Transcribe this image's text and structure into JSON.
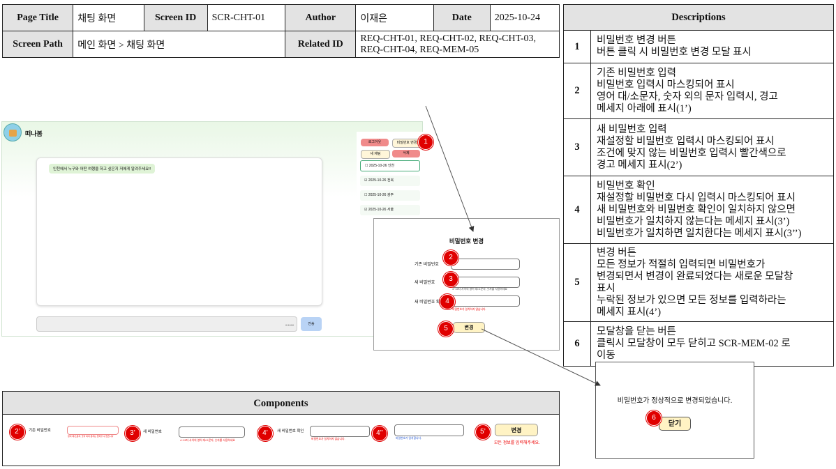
{
  "header": {
    "page_title_label": "Page Title",
    "page_title": "채팅 화면",
    "screen_id_label": "Screen ID",
    "screen_id": "SCR-CHT-01",
    "author_label": "Author",
    "author": "이재은",
    "date_label": "Date",
    "date": "2025-10-24",
    "screen_path_label": "Screen Path",
    "screen_path": "메인 화면 > 채팅 화면",
    "related_id_label": "Related ID",
    "related_id_line1": "REQ-CHT-01, REQ-CHT-02, REQ-CHT-03,",
    "related_id_line2": "REQ-CHT-04, REQ-MEM-05"
  },
  "descriptions": {
    "title": "Descriptions",
    "rows": [
      {
        "num": "1",
        "lines": [
          "비밀번호 변경 버튼",
          "버튼 클릭 시 비밀번호 변경 모달 표시"
        ]
      },
      {
        "num": "2",
        "lines": [
          "기존 비밀번호 입력",
          "비밀번호 입력시 마스킹되어  표시",
          "영어 대/소문자, 숫자 외의 문자 입력시, 경고",
          "메세지 아래에 표시(1’)"
        ]
      },
      {
        "num": "3",
        "lines": [
          "새 비밀번호 입력",
          "재설정할 비밀번호 입력시 마스킹되어 표시",
          "조건에 맞지 않는 비밀번호 입력시 빨간색으로",
          "경고 메세지 표시(2’)"
        ]
      },
      {
        "num": "4",
        "lines": [
          "비밀번호 확인",
          "재설정할 비밀번호 다시 입력시 마스킹되어 표시",
          "새 비밀번호와 비밀번호 확인이 일치하지 않으면",
          "비밀번호가 일치하지 않는다는 메세지 표시(3’)",
          "비밀번호가 일치하면 일치한다는 메세지 표시(3’’)"
        ]
      },
      {
        "num": "5",
        "lines": [
          "변경 버튼",
          "모든 정보가 적절히 입력되면 비밀번호가",
          "변경되면서 변경이 완료되었다는 새로운 모달창",
          "표시",
          "누락된 정보가 있으면 모든 정보를 입력하라는",
          "메세지 표시(4’)"
        ]
      },
      {
        "num": "6",
        "lines": [
          "모달창을 닫는 버튼",
          "클릭시 모달창이 모두 닫히고 SCR-MEM-02 로",
          "이동"
        ]
      }
    ]
  },
  "app": {
    "brand": "떠나봄",
    "chat_message": "인천에서 누구와 어떤 여행을 하고 싶은지 저에게 알려주세요!!",
    "char_count": "0/1000",
    "send_label": "전송",
    "btn_logout": "로그아웃",
    "btn_change_pw": "비밀번호 변경",
    "btn_new_chat": "새 채팅",
    "btn_delete": "삭제",
    "history": [
      "2025-10-26 인천",
      "2025-10-26 전북",
      "2025-10-26 광주",
      "2025-10-26 서울"
    ]
  },
  "modal": {
    "title": "비밀번호 변경",
    "current_label": "기존 비밀번호",
    "new_label": "새 비밀번호",
    "new_hint": "4~15자 사이의 영어 대/소문자, 숫자를 사용하세요",
    "confirm_label": "새 비밀번호 확인",
    "confirm_error": "비밀번호가 일치하지 않습니다.",
    "change_button": "변경"
  },
  "success_modal": {
    "message": "비밀번호가 정상적으로 변경되었습니다.",
    "close_button": "닫기"
  },
  "components": {
    "title": "Components",
    "c1_badge": "2’",
    "c1_label": "기존 비밀번호",
    "c1_warning": "영어 대/소문자, 숫자 외의 문자는 입력할 수 없습니다",
    "c2_badge": "3’",
    "c2_label": "새 비밀번호",
    "c2_hint": "4~15자 사이의 영어 대/소문자, 숫자를 사용하세요",
    "c3_badge": "4’",
    "c3_label": "새 비밀번호 확인",
    "c3_error": "비밀번호가 일치하지 않습니다.",
    "c4_badge": "4’’",
    "c4_ok": "비밀번호가 일치합니다.",
    "c5_badge": "5’",
    "c5_button": "변경",
    "c5_error": "모든 정보를 입력해주세요."
  },
  "badges": [
    "1",
    "2",
    "3",
    "4",
    "5",
    "6"
  ]
}
